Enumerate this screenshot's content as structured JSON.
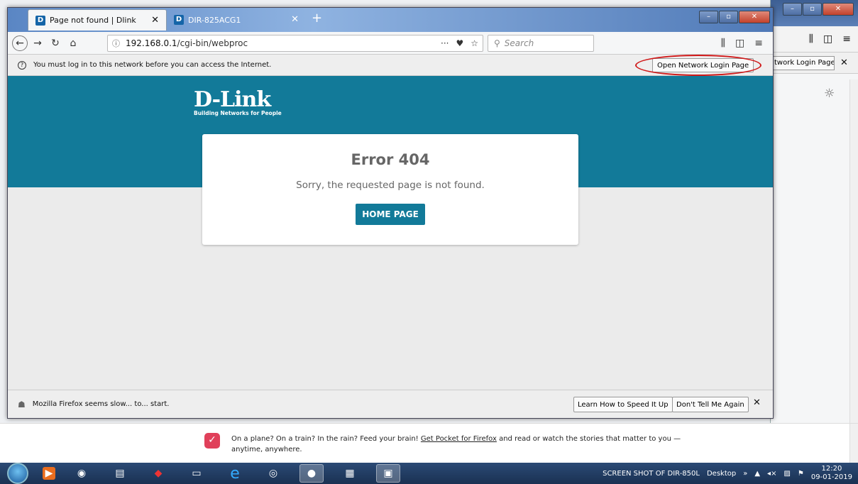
{
  "tabs": [
    {
      "label": "Page not found | Dlink",
      "favicon": "D"
    },
    {
      "label": "DIR-825ACG1",
      "favicon": "D"
    }
  ],
  "navbar": {
    "url_host": "192.168.0.1",
    "url_path": "/cgi-bin/webproc",
    "search_placeholder": "Search"
  },
  "captive": {
    "message": "You must log in to this network before you can access the Internet.",
    "login_button": "Open Network Login Page"
  },
  "bg_window": {
    "login_button": "twork Login Page"
  },
  "page": {
    "brand": "D-Link",
    "tagline": "Building Networks for People",
    "error_title": "Error 404",
    "error_message": "Sorry, the requested page is not found.",
    "home_button": "HOME PAGE",
    "colors": {
      "banner": "#127a99",
      "button": "#127a99"
    }
  },
  "slowbar": {
    "message": "Mozilla Firefox seems slow... to... start.",
    "learn_button": "Learn How to Speed It Up",
    "dont_tell_button": "Don't Tell Me Again"
  },
  "pocket": {
    "text_before": "On a plane? On a train? In the rain? Feed your brain!",
    "link": "Get Pocket for Firefox",
    "text_after": "and read or watch the stories that matter to you —",
    "line2": "anytime, anywhere."
  },
  "taskbar": {
    "toolbar_label": "SCREEN SHOT OF DIR-850L",
    "desktop_label": "Desktop",
    "time": "12:20",
    "date": "09-01-2019"
  }
}
